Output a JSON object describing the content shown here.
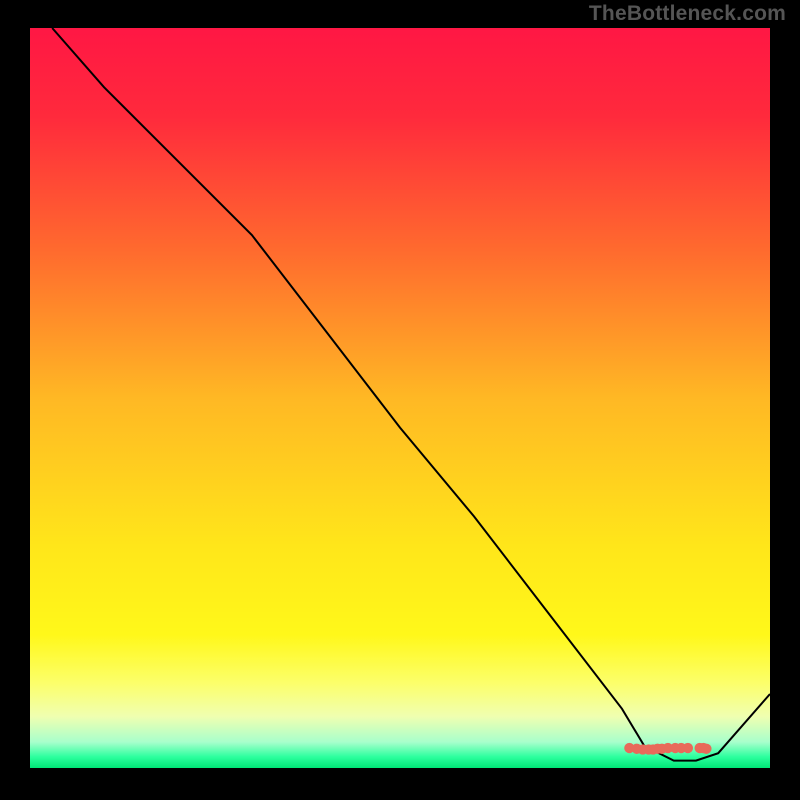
{
  "watermark": "TheBottleneck.com",
  "chart_data": {
    "type": "line",
    "title": "",
    "xlabel": "",
    "ylabel": "",
    "xlim": [
      0,
      100
    ],
    "ylim": [
      0,
      100
    ],
    "grid": false,
    "legend": false,
    "background_gradient": {
      "stops": [
        {
          "pos": 0.0,
          "color": "#ff1744"
        },
        {
          "pos": 0.12,
          "color": "#ff2a3c"
        },
        {
          "pos": 0.3,
          "color": "#ff6a2e"
        },
        {
          "pos": 0.5,
          "color": "#ffb824"
        },
        {
          "pos": 0.7,
          "color": "#ffe61a"
        },
        {
          "pos": 0.82,
          "color": "#fff81a"
        },
        {
          "pos": 0.885,
          "color": "#fcff6a"
        },
        {
          "pos": 0.93,
          "color": "#f0ffb0"
        },
        {
          "pos": 0.965,
          "color": "#a8ffcc"
        },
        {
          "pos": 0.985,
          "color": "#2cff9e"
        },
        {
          "pos": 1.0,
          "color": "#00e676"
        }
      ]
    },
    "series": [
      {
        "name": "bottleneck-curve",
        "color": "#000000",
        "x": [
          3,
          10,
          20,
          30,
          40,
          50,
          60,
          70,
          80,
          83,
          87,
          90,
          93,
          100
        ],
        "y": [
          100,
          92,
          82,
          72,
          59,
          46,
          34,
          21,
          8,
          3,
          1,
          1,
          2,
          10
        ]
      }
    ],
    "markers": {
      "name": "optimal-band-dots",
      "color": "#e86a5a",
      "points": [
        {
          "x": 81.0,
          "y": 2.7
        },
        {
          "x": 82.0,
          "y": 2.6
        },
        {
          "x": 82.8,
          "y": 2.5
        },
        {
          "x": 83.6,
          "y": 2.5
        },
        {
          "x": 84.2,
          "y": 2.5
        },
        {
          "x": 84.8,
          "y": 2.6
        },
        {
          "x": 85.4,
          "y": 2.6
        },
        {
          "x": 86.2,
          "y": 2.7
        },
        {
          "x": 87.2,
          "y": 2.7
        },
        {
          "x": 88.0,
          "y": 2.7
        },
        {
          "x": 88.9,
          "y": 2.7
        },
        {
          "x": 90.5,
          "y": 2.7
        },
        {
          "x": 91.0,
          "y": 2.7
        },
        {
          "x": 91.4,
          "y": 2.6
        }
      ]
    }
  }
}
